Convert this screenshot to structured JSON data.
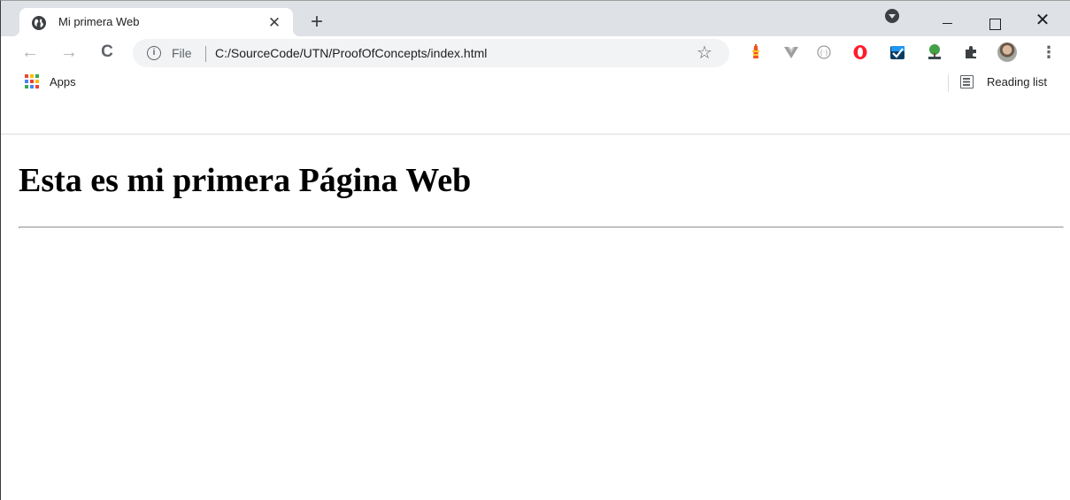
{
  "tab": {
    "title": "Mi primera Web",
    "close_label": "✕",
    "new_tab_label": "+",
    "favicon_icon": "globe-icon"
  },
  "window_controls": {
    "minimize_icon": "minimize-icon",
    "maximize_icon": "maximize-icon",
    "close_label": "✕"
  },
  "toolbar": {
    "back_label": "←",
    "forward_label": "→",
    "reload_label": "C",
    "info_label": "i",
    "scheme_label": "File",
    "url": "C:/SourceCode/UTN/ProofOfConcepts/index.html",
    "bookmark_star": "☆",
    "menu_label": "⋮",
    "extensions": [
      "lighthouse-icon",
      "vue-devtools-icon",
      "json-formatter-icon",
      "opera-icon",
      "todo-check-icon",
      "html-tree-icon",
      "puzzle-extensions-icon"
    ]
  },
  "bookmarks_bar": {
    "apps_label": "Apps",
    "reading_list_label": "Reading list"
  },
  "page": {
    "heading": "Esta es mi primera Página Web"
  },
  "colors": {
    "tabstrip_bg": "#dee1e6",
    "omnibox_bg": "#f1f3f4",
    "text_primary": "#202124",
    "icon_gray": "#5f6368"
  }
}
